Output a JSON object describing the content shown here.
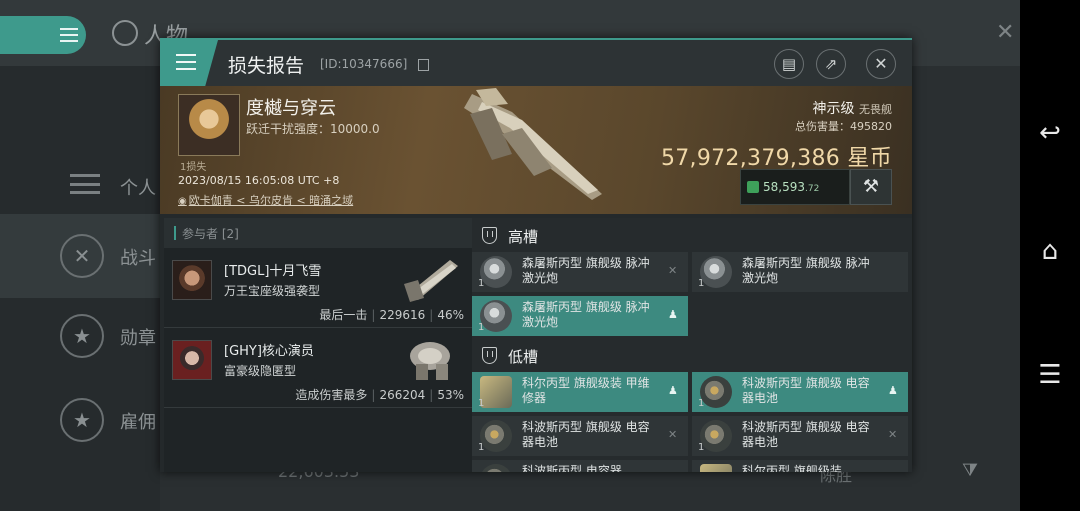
{
  "background": {
    "title": "人物",
    "sidebar": [
      "个人",
      "战斗",
      "勋章",
      "雇佣"
    ],
    "bottom_value": "22,603.53",
    "bottom_right": "陈胜"
  },
  "modal": {
    "title": "损失报告",
    "id": "[ID:10347666]"
  },
  "victim": {
    "name": "度樾与穿云",
    "warp_scramble": "跃迁干扰强度：10000.0",
    "loss_count": "1损失",
    "time": "2023/08/15 16:05:08 UTC +8",
    "location": "欧卡伽青 < 乌尔皮肯 < 暗涌之域",
    "ship_class": "神示级",
    "ship_type": "无畏舰",
    "total_damage": "总伤害量：495820",
    "isk_value": "57,972,379,386 星币",
    "plex_value": "58,593",
    "plex_decimal": ".72"
  },
  "participants": {
    "title": "参与者 [2]",
    "rows": [
      {
        "name": "[TDGL]十月飞雪",
        "ship": "万王宝座级强袭型",
        "label": "最后一击",
        "damage": "229616",
        "percent": "46%"
      },
      {
        "name": "[GHY]核心演员",
        "ship": "富豪级隐匿型",
        "label": "造成伤害最多",
        "damage": "266204",
        "percent": "53%"
      }
    ]
  },
  "slots": {
    "high_label": "高槽",
    "low_label": "低槽",
    "high": [
      {
        "name": "森屠斯丙型 旗舰级 脉冲激光炮",
        "qty": "1",
        "mark": "✕"
      },
      {
        "name": "森屠斯丙型 旗舰级 脉冲激光炮",
        "qty": "1",
        "mark": ""
      },
      {
        "name": "森屠斯丙型 旗舰级 脉冲激光炮",
        "qty": "1",
        "mark": "♟"
      }
    ],
    "low": [
      {
        "name": "科尔丙型 旗舰级装 甲维修器",
        "qty": "1",
        "mark": "♟"
      },
      {
        "name": "科波斯丙型 旗舰级 电容器电池",
        "qty": "1",
        "mark": "♟"
      },
      {
        "name": "科波斯丙型 旗舰级 电容器电池",
        "qty": "1",
        "mark": "✕"
      },
      {
        "name": "科波斯丙型 旗舰级 电容器电池",
        "qty": "1",
        "mark": "✕"
      },
      {
        "name": "科波斯丙型 电容器",
        "qty": "",
        "mark": ""
      },
      {
        "name": "科尔丙型 旗舰级装",
        "qty": "",
        "mark": ""
      }
    ]
  },
  "colors": {
    "accent": "#3e9a8c",
    "isk": "#f0d8a8",
    "plex": "#3ea05a"
  }
}
